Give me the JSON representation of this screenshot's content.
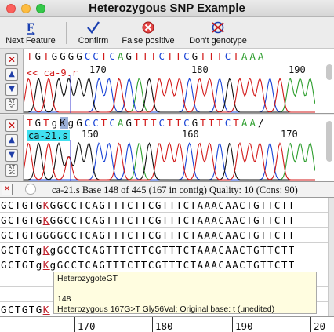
{
  "window": {
    "title": "Heterozygous SNP Example"
  },
  "toolbar": {
    "next_feature": "Next Feature",
    "confirm": "Confirm",
    "false_positive": "False positive",
    "dont_genotype": "Don't genotype"
  },
  "trace1": {
    "sequence": "TGTGGGGCCTCAGTTTCTTCGTTTCTAAA",
    "label": "<< ca-9.r",
    "ticks": [
      "170",
      "180",
      "190"
    ]
  },
  "trace2": {
    "sequence_pre": "TGTg",
    "sequence_het": "K",
    "sequence_post": "gGCCTCAGTTTCTTCGTTTCTAA/",
    "label": "ca-21.s",
    "ticks": [
      "150",
      "160",
      "170"
    ]
  },
  "status": {
    "text": "ca-21.s  Base 148 of 445 (167 in contig) Quality: 10 (Cons: 90)"
  },
  "alignment": {
    "rows": [
      {
        "pre": "GCTGTG",
        "k": "K",
        "post": "GGCCTCAGTTTCTTCGTTTCTAAACAACTGTTCTT"
      },
      {
        "pre": "GCTGTG",
        "k": "K",
        "post": "GGCCTCAGTTTCTTCGTTTCTAAACAACTGTTCTT"
      },
      {
        "pre": "GCTGTGGGGCCTCAGTTTCTTCGTTTCTAAACAACTGTTCTT",
        "k": "",
        "post": ""
      },
      {
        "pre": "GCTGTg",
        "k": "K",
        "post": "gGCCTCAGTTTCTTCGTTTCTAAACAACTGTTCTT"
      },
      {
        "pre": "GCTGTg",
        "k": "K",
        "post": "gGCCTCAGTTTCTTCGTTTCTAAACAACTGTTCTT"
      }
    ],
    "bottom_row": {
      "pre": "GCTGTG",
      "k": "K",
      "post": ""
    }
  },
  "tooltip": {
    "line1": "HeterozygoteGT",
    "line2": "148",
    "line3": "Heterozygous 167G>T Gly56Val; Original base: t (unedited)"
  },
  "ruler": {
    "ticks": [
      "170",
      "180",
      "190",
      "20"
    ]
  },
  "colors": {
    "A": "#2e9e2e",
    "C": "#1a44d6",
    "G": "#111111",
    "T": "#d21a1a",
    "highlight": "#40e0f0"
  }
}
